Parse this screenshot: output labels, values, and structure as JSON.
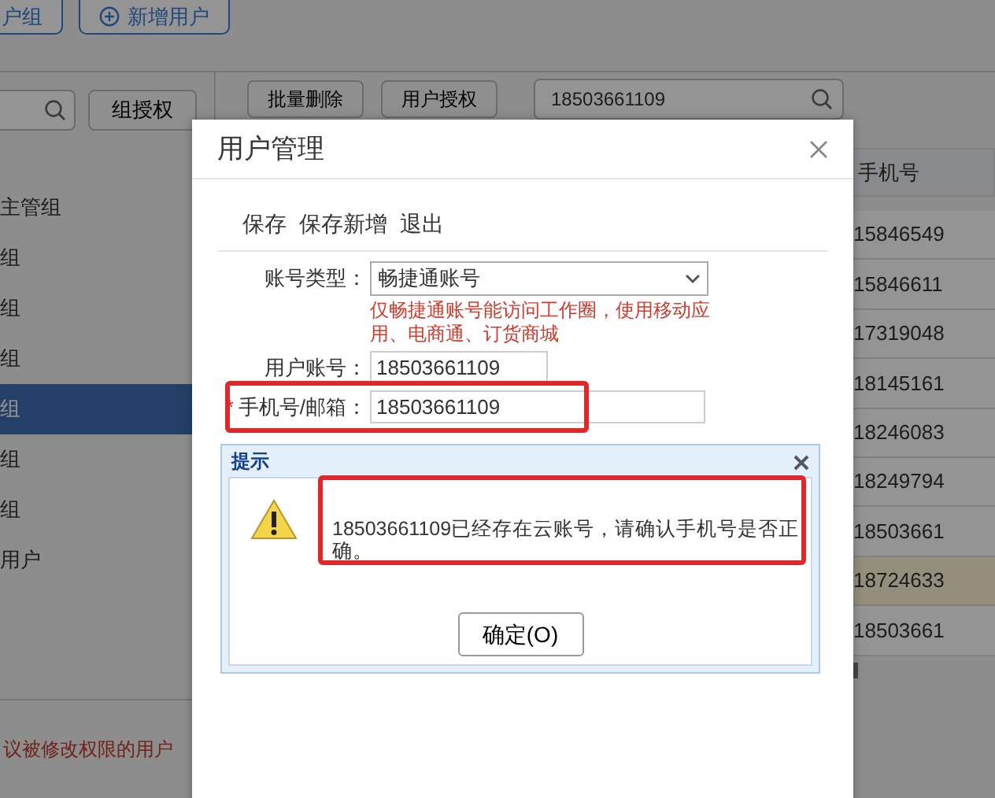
{
  "page": {
    "top_buttons": [
      {
        "label": "户组",
        "icon": false
      },
      {
        "label": "新增用户",
        "icon": true
      }
    ],
    "group_auth_button": "组授权",
    "sidebar": {
      "items": [
        {
          "label": "主管组",
          "selected": false
        },
        {
          "label": "组",
          "selected": false
        },
        {
          "label": "组",
          "selected": false
        },
        {
          "label": "组",
          "selected": false
        },
        {
          "label": "组",
          "selected": true
        },
        {
          "label": "组",
          "selected": false
        },
        {
          "label": "组",
          "selected": false
        },
        {
          "label": "用户",
          "selected": false
        }
      ]
    },
    "footer_note": "议被修改权限的用户",
    "toolbar": {
      "buttons": [
        "批量删除",
        "用户授权"
      ],
      "search": {
        "value": "18503661109"
      }
    },
    "table": {
      "columns": [
        "手机号"
      ],
      "rows": [
        {
          "cells": [
            "15846549"
          ],
          "selected": false
        },
        {
          "cells": [
            "15846611"
          ],
          "selected": false
        },
        {
          "cells": [
            "17319048"
          ],
          "selected": false
        },
        {
          "cells": [
            "18145161"
          ],
          "selected": false
        },
        {
          "cells": [
            "18246083"
          ],
          "selected": false
        },
        {
          "cells": [
            "18249794"
          ],
          "selected": false
        },
        {
          "cells": [
            "18503661"
          ],
          "selected": false
        },
        {
          "cells": [
            "18724633"
          ],
          "selected": true
        },
        {
          "cells": [
            "18503661"
          ],
          "selected": false
        }
      ]
    }
  },
  "modal": {
    "title": "用户管理",
    "actions": [
      "保存",
      "保存新增",
      "退出"
    ],
    "fields": [
      {
        "label": "账号类型：",
        "kind": "select",
        "value": "畅捷通账号",
        "hint": "仅畅捷通账号能访问工作圈，使用移动应用、电商通、订货商城",
        "highlighted": false
      },
      {
        "label": "用户账号：",
        "kind": "text",
        "value": "18503661109",
        "highlighted": false
      },
      {
        "label": "手机号/邮箱：",
        "kind": "text",
        "value": "18503661109",
        "required_mark": "*",
        "highlighted": true
      }
    ]
  },
  "alert": {
    "title": "提示",
    "message": "18503661109已经存在云账号，请确认手机号是否正确。",
    "button": "确定(O)",
    "highlighted": true
  }
}
